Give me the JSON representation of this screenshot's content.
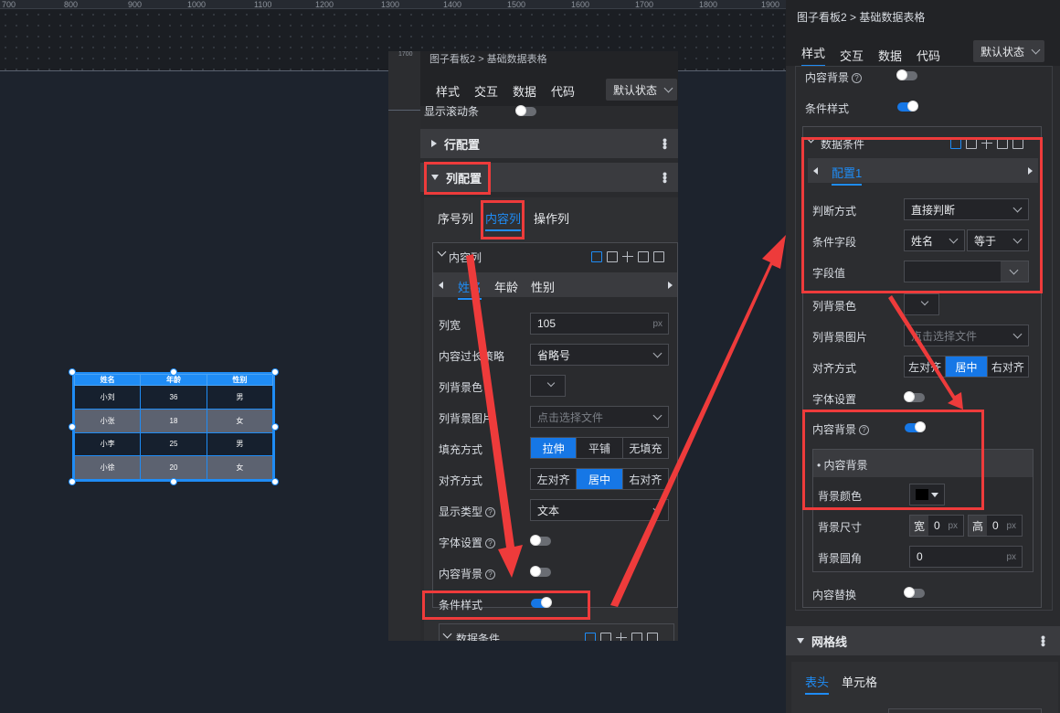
{
  "ruler": {
    "ticks": [
      "700",
      "800",
      "900",
      "1000",
      "1100",
      "1200",
      "1300",
      "1400",
      "1500",
      "1600",
      "1700",
      "1800",
      "1900"
    ],
    "small_tick": "1700"
  },
  "mini_table": {
    "headers": [
      "姓名",
      "年龄",
      "性别"
    ],
    "rows": [
      [
        "小刘",
        "36",
        "男"
      ],
      [
        "小张",
        "18",
        "女"
      ],
      [
        "小李",
        "25",
        "男"
      ],
      [
        "小徐",
        "20",
        "女"
      ]
    ]
  },
  "common": {
    "breadcrumb_root": "图子看板2",
    "breadcrumb_sep": ">",
    "breadcrumb_current": "基础数据表格",
    "tabs": [
      "样式",
      "交互",
      "数据",
      "代码"
    ],
    "state_select": "默认状态"
  },
  "middle": {
    "show_scrollbar": "显示滚动条",
    "row_config": "行配置",
    "col_config": "列配置",
    "col_tabs": [
      "序号列",
      "内容列",
      "操作列"
    ],
    "content_col_title": "内容列",
    "field_tabs": [
      "姓名",
      "年龄",
      "性别"
    ],
    "width_label": "列宽",
    "width_value": "105",
    "unit": "px",
    "overflow_label": "内容过长策略",
    "overflow_value": "省略号",
    "bgcolor_label": "列背景色",
    "bgimg_label": "列背景图片",
    "bgimg_placeholder": "点击选择文件",
    "fill_label": "填充方式",
    "fill_options": [
      "拉伸",
      "平铺",
      "无填充"
    ],
    "align_label": "对齐方式",
    "align_options": [
      "左对齐",
      "居中",
      "右对齐"
    ],
    "display_label": "显示类型",
    "display_value": "文本",
    "font_label": "字体设置",
    "content_bg_label": "内容背景",
    "cond_style_label": "条件样式",
    "data_cond": "数据条件"
  },
  "right": {
    "content_bg_label": "内容背景",
    "cond_style_label": "条件样式",
    "data_cond": "数据条件",
    "config_tab": "配置1",
    "judge_label": "判断方式",
    "judge_value": "直接判断",
    "field_label": "条件字段",
    "field_value": "姓名",
    "op_value": "等于",
    "value_label": "字段值",
    "bgcolor_label": "列背景色",
    "bgimg_label": "列背景图片",
    "bgimg_placeholder": "点击选择文件",
    "align_label": "对齐方式",
    "align_options": [
      "左对齐",
      "居中",
      "右对齐"
    ],
    "font_label": "字体设置",
    "content_bg_label2": "内容背景",
    "content_bg_section": "内容背景",
    "bg_color_label": "背景颜色",
    "bg_size_label": "背景尺寸",
    "size_w": "宽",
    "size_w_val": "0",
    "size_h": "高",
    "size_h_val": "0",
    "unit": "px",
    "bg_radius_label": "背景圆角",
    "bg_radius_val": "0",
    "content_replace_label": "内容替换",
    "grid_label": "网格线",
    "grid_tabs": [
      "表头",
      "单元格"
    ]
  }
}
